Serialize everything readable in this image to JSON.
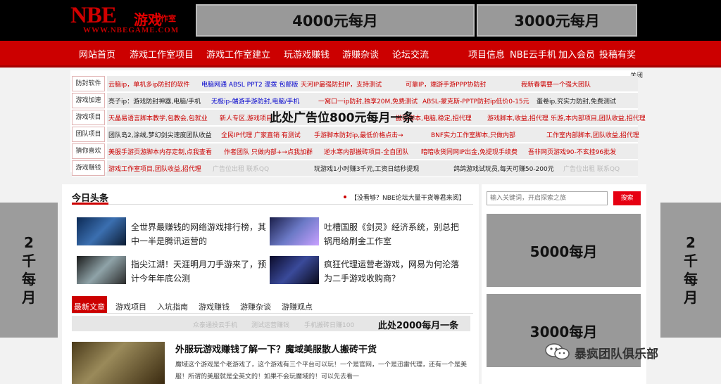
{
  "logo": {
    "main": "NBE",
    "cn": "游戏",
    "small": "工作室",
    "url": "WWW.NBEGAME.COM"
  },
  "top_ads": {
    "ad1": "4000元每月",
    "ad2": "3000元每月"
  },
  "nav": {
    "left": [
      "网站首页",
      "游戏工作室项目",
      "游戏工作室建立",
      "玩游戏赚钱",
      "游赚杂谈",
      "论坛交流"
    ],
    "right": [
      "项目信息",
      "NBE云手机",
      "加入会员",
      "投稿有奖"
    ]
  },
  "panel": {
    "close": "关闭",
    "overlay_ad": "此处广告位800元每月一条",
    "rows": [
      {
        "label": "防封软件",
        "links": [
          "云脑ip，单机多ip防封的软件",
          "电脑网通 ABSL PPT2 混拨 包邮版",
          "天河IP最强防封IP，支持测试",
          "可靠IP，端游手游PPP协防封",
          "我新春需要一个强大团队"
        ]
      },
      {
        "label": "游戏加速",
        "links": [
          "亮子ip：游戏防封神器,电脑/手机",
          "无极ip-端游手游防封,电脑/手机",
          "一窝口一ip防封,独享20M,免费测试",
          "ABSL-蒙克斯-PPTP防封ip低价0-15元",
          "蛋卷ip,究实力防封,免费测试"
        ]
      },
      {
        "label": "游戏项目",
        "links": [
          "天晶易语言脚本教学,包教会,包就业",
          "新人专区,游戏项目",
          "搬砖脚本,电脑,稳定,招代理",
          "游戏脚本,收益,招代理",
          "乐游,本内部项目,团队收益,招代理"
        ]
      },
      {
        "label": "团队项目",
        "links": [
          "团队岛2,涂绒,梦幻剑尖速度团队收益",
          "全民IP代理 广家直销 有测试",
          "手游脚本防封ip,最低价格点击→",
          "BNF实力工作室脚本,只做内部",
          "工作室内部脚本,团队收益,招代理"
        ]
      },
      {
        "label": "猜你喜欢",
        "links": [
          "美服手游页游脚本内存定制,点我查看",
          "作者团队 只做内部+→点我加群",
          "逆水寒内部搬砖项目-全自团队",
          "暗暗收货同网IP出金,免提现手续费",
          "吾非网页游戏90-不玄挂96批发"
        ]
      },
      {
        "label": "游戏赚钱",
        "links": [
          "游戏工作室项目,团队收益,招代理",
          "广告位出租 联系QQ",
          "玩游戏1小时赚3千元,工资日结秒提现",
          "鸽鸽游戏试玩员,每天可赚50-200元",
          "广告位出租 联系QQ"
        ]
      }
    ]
  },
  "side_ads": {
    "left": "2千每月",
    "right": "2千每月"
  },
  "headlines": {
    "title": "今日头条",
    "notice": "【没看够？NBE论坛大量干货等君来阅】",
    "items": [
      {
        "text": "全世界最赚钱的网络游戏排行榜，其中一半是腾讯运营的"
      },
      {
        "text": "吐槽国服《剑灵》经济系统，别总把锅甩给刷金工作室"
      },
      {
        "text": "指尖江湖！天涯明月刀手游来了，预计今年年底公测"
      },
      {
        "text": "疯狂代理运营老游戏，网易为何沦落为二手游戏收购商？"
      }
    ]
  },
  "tabs": [
    "最新文章",
    "游戏项目",
    "入坑指南",
    "游戏赚钱",
    "游赚杂谈",
    "游赚观点"
  ],
  "mid_ad": {
    "faded": [
      "众泰通投云手机",
      "测试运营赚钱",
      "手机搬砖日赚100"
    ],
    "text": "此处2000每月一条"
  },
  "article": {
    "title": "外服玩游戏赚钱了解一下？魔域美服散人搬砖干货",
    "excerpt": "魔域这个游戏是个老游戏了，这个游戏有三个平台可以玩！一个是官网，一个是迅雷代理，还有一个是美服！所谓的美服就是全英文的！如果不会玩魔域的！可以先去看一"
  },
  "search": {
    "placeholder": "输入关键词，开启探索之旅",
    "button": "搜索"
  },
  "right_ads": {
    "ad1": "5000每月",
    "ad2": "3000每月"
  },
  "watermark": "暴疯团队俱乐部",
  "colors": {
    "brand_red": "#cc0000",
    "ad_gray": "#999999"
  }
}
